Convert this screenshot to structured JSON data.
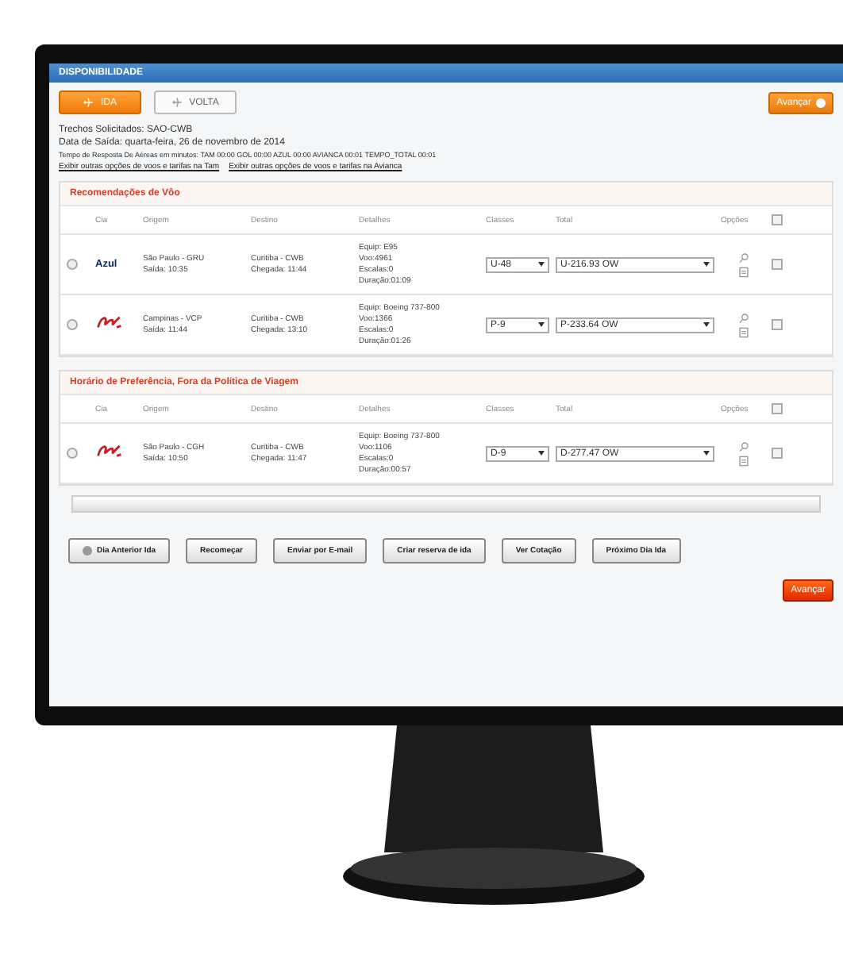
{
  "window": {
    "title": "DISPONIBILIDADE"
  },
  "tabs": [
    {
      "label": "IDA",
      "selected": true
    },
    {
      "label": "VOLTA",
      "selected": false
    }
  ],
  "advance_top": "Avançar",
  "info": {
    "lines": [
      "Trechos Solicitados: SAO-CWB",
      "Data de Saída: quarta-feira, 26 de novembro de 2014",
      "Tempo de Resposta De Aéreas em minutos: TAM 00:00 GOL 00:00 AZUL 00:00 AVIANCA 00:01 TEMPO_TOTAL 00:01"
    ],
    "links": [
      "Exibir outras opções de voos e tarifas na Tam",
      "Exibir outras opções de voos e tarifas na Avianca"
    ]
  },
  "sections": [
    {
      "title": "Recomendações de Vôo",
      "all_checked": false,
      "columns": [
        "Cia",
        "Origem",
        "Destino",
        "Detalhes",
        "Classes",
        "Total",
        "Opções"
      ],
      "rows": [
        {
          "selected": false,
          "airline": {
            "kind": "wordmark",
            "text": "Azul"
          },
          "origin": "São Paulo - GRU",
          "departure": "Saída: 10:35",
          "destination": "Curitiba - CWB",
          "arrival": "Chegada: 11:44",
          "details": [
            "Equip: E95",
            "Voo:4961",
            "Escalas:0",
            "Duração:01:09"
          ],
          "class": "U-48",
          "total": "U-216.93 OW",
          "checked": false
        },
        {
          "selected": false,
          "airline": {
            "kind": "swirl"
          },
          "origin": "Campinas - VCP",
          "departure": "Saída: 11:44",
          "destination": "Curitiba - CWB",
          "arrival": "Chegada: 13:10",
          "details": [
            "Equip: Boeing 737-800",
            "Voo:1366",
            "Escalas:0",
            "Duração:01:26"
          ],
          "class": "P-9",
          "total": "P-233.64 OW",
          "checked": false
        }
      ]
    },
    {
      "title": "Horário de Preferência, Fora da Política de Viagem",
      "all_checked": false,
      "columns": [
        "Cia",
        "Origem",
        "Destino",
        "Detalhes",
        "Classes",
        "Total",
        "Opções"
      ],
      "rows": [
        {
          "selected": false,
          "airline": {
            "kind": "swirl"
          },
          "origin": "São Paulo - CGH",
          "departure": "Saída: 10:50",
          "destination": "Curitiba - CWB",
          "arrival": "Chegada: 11:47",
          "details": [
            "Equip: Boeing 737-800",
            "Voo:1106",
            "Escalas:0",
            "Duração:00:57"
          ],
          "class": "D-9",
          "total": "D-277.47 OW",
          "checked": false
        }
      ]
    }
  ],
  "buttons": [
    "Dia Anterior Ida",
    "Recomeçar",
    "Enviar por E-mail",
    "Criar reserva de ida",
    "Ver Cotação",
    "Próximo Dia Ida"
  ],
  "advance_bottom": "Avançar"
}
